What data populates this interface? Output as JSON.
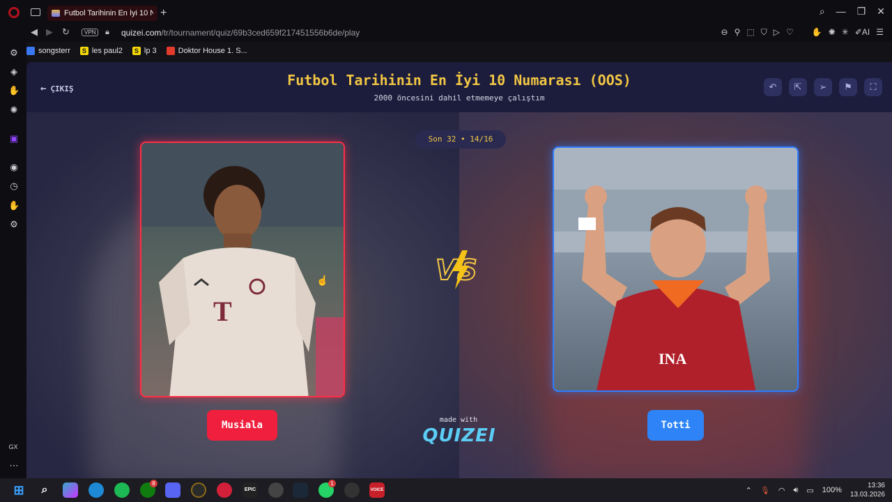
{
  "browser": {
    "tab_title": "Futbol Tarihinin En İyi 10 N",
    "vpn_label": "VPN",
    "url_host": "quizei.com",
    "url_path": "/tr/tournament/quiz/69b3ced659f217451556b6de/play",
    "ai_label": "AI",
    "sidebar_gx_label": "GX",
    "bookmarks": [
      {
        "label": "songsterr",
        "icon_color": "#3a78f2",
        "glyph": ""
      },
      {
        "label": "les paul2",
        "icon_color": "#f5d90a",
        "glyph": "S"
      },
      {
        "label": "lp 3",
        "icon_color": "#f5d90a",
        "glyph": "S"
      },
      {
        "label": "Doktor House 1. S...",
        "icon_color": "#e23b2e",
        "glyph": ""
      }
    ]
  },
  "quiz": {
    "exit_label": "ÇIKIŞ",
    "title": "Futbol Tarihinin En İyi 10 Numarası (OOS)",
    "subtitle": "2000 öncesini dahil etmemeye çalıştım",
    "round": "Son 32 • 14/16",
    "left_name": "Musiala",
    "right_name": "Totti",
    "made_with": "made with",
    "brand": "QUIZEI"
  },
  "colors": {
    "title_yellow": "#f2c744",
    "left_accent": "#ef1f3d",
    "right_accent": "#2e84f6",
    "brand_cyan": "#5ccdf4"
  },
  "taskbar": {
    "battery": "100%",
    "time": "13:36",
    "date": "13.03.2026",
    "xbox_badge": "8",
    "whatsapp_badge": "1",
    "epic_label": "EPIC",
    "voice_label": "VOICE"
  }
}
